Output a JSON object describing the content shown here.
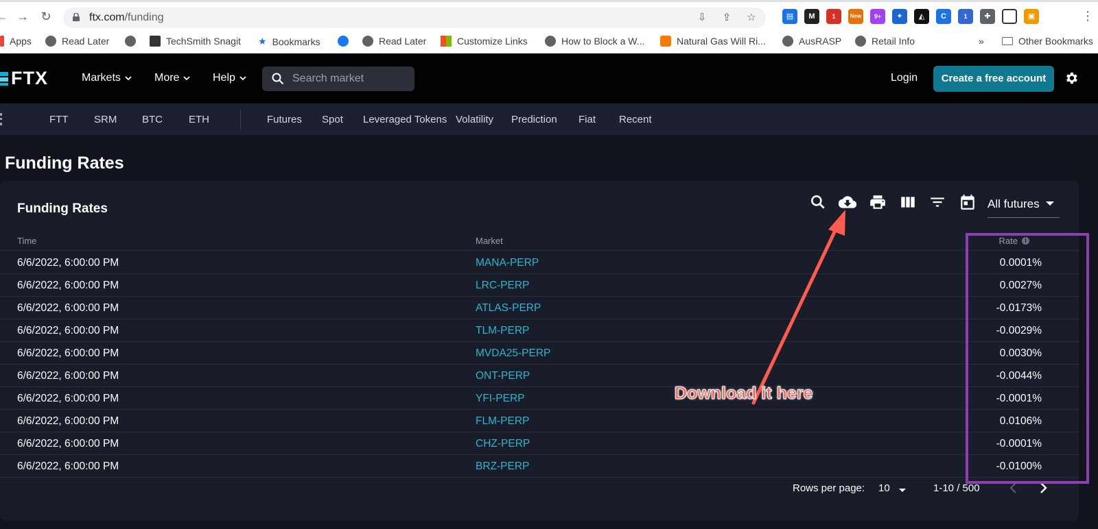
{
  "browser": {
    "url_domain": "ftx.com",
    "url_path": "/funding",
    "bookmarks": [
      "Apps",
      "Read Later",
      "TechSmith Snagit",
      "Bookmarks",
      "Read Later",
      "Customize Links",
      "How to Block a W...",
      "Natural Gas Will Ri...",
      "AusRASP",
      "Retail Info"
    ],
    "overflow": "»",
    "other_bookmarks": "Other Bookmarks",
    "extension_badges": [
      "1",
      "New",
      "9+",
      "1"
    ]
  },
  "header": {
    "logo": "FTX",
    "nav": [
      "Markets",
      "More",
      "Help"
    ],
    "search_placeholder": "Search market",
    "login": "Login",
    "cta": "Create a free account"
  },
  "subnav": {
    "coins": [
      "FTT",
      "SRM",
      "BTC",
      "ETH"
    ],
    "categories": [
      "Futures",
      "Spot",
      "Leveraged Tokens",
      "Volatility",
      "Prediction",
      "Fiat",
      "Recent"
    ]
  },
  "page": {
    "title": "Funding Rates",
    "card_title": "Funding Rates",
    "filter_value": "All futures",
    "toolbar_icons": [
      "search-icon",
      "cloud-download-icon",
      "print-icon",
      "columns-icon",
      "filter-icon",
      "calendar-icon"
    ]
  },
  "table": {
    "columns": [
      "Time",
      "Market",
      "Rate"
    ],
    "rows": [
      {
        "time": "6/6/2022, 6:00:00 PM",
        "market": "MANA-PERP",
        "rate": "0.0001%"
      },
      {
        "time": "6/6/2022, 6:00:00 PM",
        "market": "LRC-PERP",
        "rate": "0.0027%"
      },
      {
        "time": "6/6/2022, 6:00:00 PM",
        "market": "ATLAS-PERP",
        "rate": "-0.0173%"
      },
      {
        "time": "6/6/2022, 6:00:00 PM",
        "market": "TLM-PERP",
        "rate": "-0.0029%"
      },
      {
        "time": "6/6/2022, 6:00:00 PM",
        "market": "MVDA25-PERP",
        "rate": "0.0030%"
      },
      {
        "time": "6/6/2022, 6:00:00 PM",
        "market": "ONT-PERP",
        "rate": "-0.0044%"
      },
      {
        "time": "6/6/2022, 6:00:00 PM",
        "market": "YFI-PERP",
        "rate": "-0.0001%"
      },
      {
        "time": "6/6/2022, 6:00:00 PM",
        "market": "FLM-PERP",
        "rate": "0.0106%"
      },
      {
        "time": "6/6/2022, 6:00:00 PM",
        "market": "CHZ-PERP",
        "rate": "-0.0001%"
      },
      {
        "time": "6/6/2022, 6:00:00 PM",
        "market": "BRZ-PERP",
        "rate": "-0.0100%"
      }
    ]
  },
  "pagination": {
    "rows_label": "Rows per page:",
    "rows_value": "10",
    "range": "1-10 / 500"
  },
  "annotation": {
    "text": "Download it here",
    "arrow_color": "#ff5b4f",
    "highlight_color": "#8b3fb0"
  },
  "colors": {
    "accent": "#11798f",
    "link": "#2eb5cf",
    "background": "#12141d",
    "card": "#191d29"
  }
}
